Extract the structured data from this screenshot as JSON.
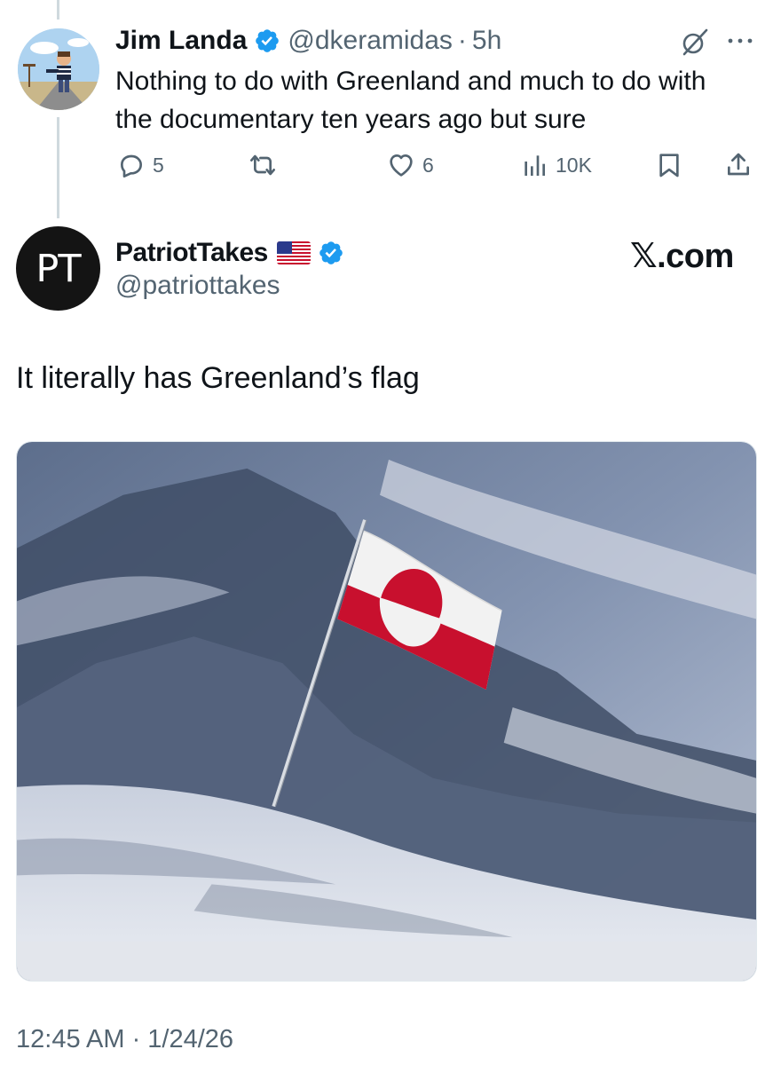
{
  "reply": {
    "name": "Jim Landa",
    "handle": "@dkeramidas",
    "separator": "·",
    "time": "5h",
    "text": "Nothing to do with Greenland and much to do with the documentary ten years ago but sure",
    "actions": {
      "replies": "5",
      "retweets": "",
      "likes": "6",
      "views": "10K"
    }
  },
  "quoted": {
    "name": "PatriotTakes",
    "handle": "@patriottakes",
    "avatar_initials": "PT",
    "watermark": "𝕏.com",
    "text": "It literally has Greenland’s flag",
    "image_description_icon": "greenland-flag-on-mountain",
    "timestamp": "12:45 AM · 1/24/26"
  },
  "colors": {
    "verified": "#1d9bf0",
    "secondary_text": "#536471",
    "primary_text": "#0f1419",
    "flag_red": "#c8102e",
    "thread_line": "#cfd9de"
  }
}
